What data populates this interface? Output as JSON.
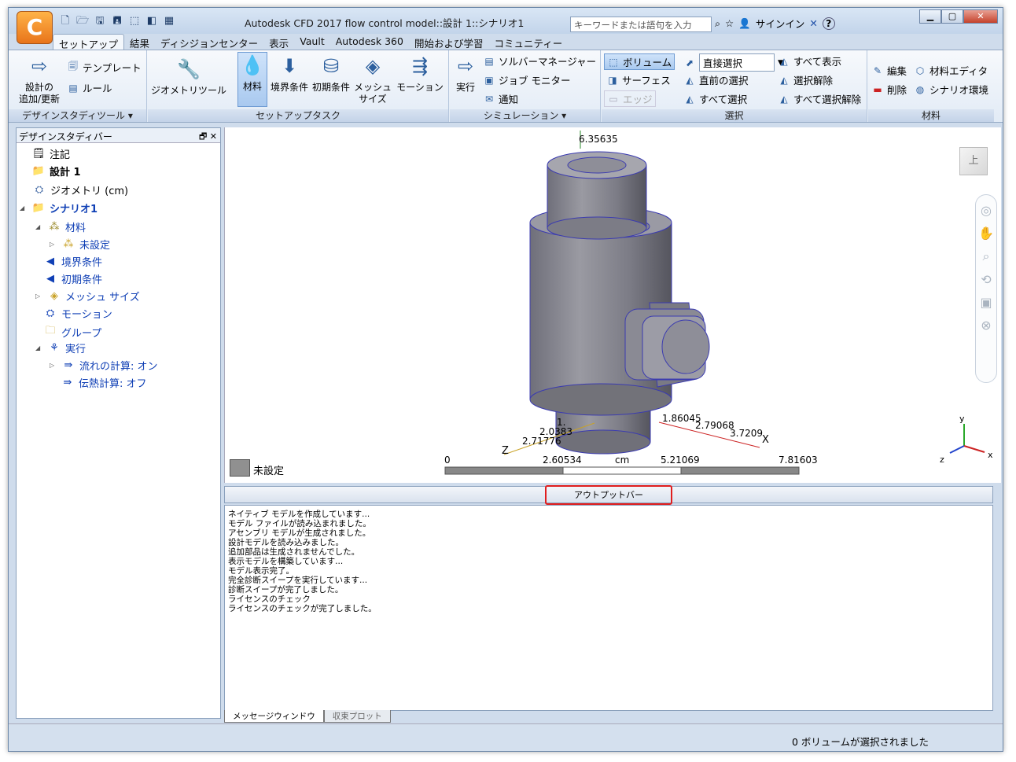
{
  "app": {
    "logo_letter": "C",
    "title": "Autodesk CFD 2017   flow control model::設計  1::シナリオ1",
    "search_placeholder": "キーワードまたは語句を入力",
    "signin": "サインイン",
    "help": "?"
  },
  "qat": [
    "new-icon",
    "open-icon",
    "save-icon",
    "save-as-icon",
    "select-icon",
    "cube-icon",
    "display-icon"
  ],
  "window_buttons": {
    "minimize": "▁",
    "maximize": "▢",
    "close": "✕"
  },
  "tabs": [
    "セットアップ",
    "結果",
    "ディシジョンセンター",
    "表示",
    "Vault",
    "Autodesk 360",
    "開始および学習",
    "コミュニティー"
  ],
  "ribbon": {
    "design_study": {
      "title": "デザインスタディツール ▾",
      "update_label": "設計の\n追加/更新",
      "template": "テンプレート",
      "rule": "ルール"
    },
    "setup_tasks": {
      "title": "セットアップタスク",
      "geometry_tools": "ジオメトリツール",
      "material": "材料",
      "boundary": "境界条件",
      "initial": "初期条件",
      "mesh": "メッシュ\nサイズ",
      "motion": "モーション"
    },
    "simulation": {
      "title": "シミュレーション ▾",
      "run": "実行",
      "solver_manager": "ソルバーマネージャー",
      "job_monitor": "ジョブ モニター",
      "notify": "通知"
    },
    "selection": {
      "title": "選択",
      "volume": "ボリューム",
      "surface": "サーフェス",
      "edge": "エッジ",
      "direct_select": "直接選択",
      "previous": "直前の選択",
      "select_all": "すべて選択",
      "show_all": "すべて表示",
      "deselect": "選択解除",
      "deselect_all": "すべて選択解除"
    },
    "material": {
      "title": "材料",
      "edit": "編集",
      "delete": "削除",
      "editor": "材料エディタ",
      "scenario_env": "シナリオ環境"
    }
  },
  "design_study_bar": {
    "title": "デザインスタディバー",
    "controls": "🗗 ✕",
    "tree": [
      {
        "label": "注記",
        "icon": "note-icon"
      },
      {
        "label": "設計  1",
        "icon": "design-icon"
      },
      {
        "label": "ジオメトリ (cm)",
        "icon": "geometry-icon"
      },
      {
        "label": "シナリオ1",
        "icon": "scenario-icon"
      },
      {
        "label": "材料",
        "icon": "material-icon"
      },
      {
        "label": "未設定",
        "icon": "material-icon"
      },
      {
        "label": "境界条件",
        "icon": "boundary-icon"
      },
      {
        "label": "初期条件",
        "icon": "initial-icon"
      },
      {
        "label": "メッシュ サイズ",
        "icon": "mesh-icon"
      },
      {
        "label": "モーション",
        "icon": "motion-icon"
      },
      {
        "label": "グループ",
        "icon": "group-icon"
      },
      {
        "label": "実行",
        "icon": "run-icon"
      },
      {
        "label": "流れの計算: オン",
        "icon": "flow-icon"
      },
      {
        "label": "伝熱計算: オフ",
        "icon": "heat-icon"
      }
    ]
  },
  "viewport": {
    "viewcube_label": "上",
    "ruler": {
      "t0": "0",
      "t1": "2.60534",
      "unit": "cm",
      "t2": "5.21069",
      "t3": "7.81603"
    },
    "axis_labels": {
      "top": "6.35635",
      "z1": "2.71776",
      "z2": "2.0383",
      "z3": "1.",
      "x1": "1.86045",
      "x2": "2.79068",
      "x3": "3.7209",
      "xl": "X",
      "zl": "Z",
      "x_axis": "x",
      "y_axis": "y",
      "z_axis": "z"
    },
    "legend_label": "未設定",
    "legend_color": "#909090"
  },
  "output_bar": {
    "label": "アウトプットバー",
    "messages": [
      "ネイティブ モデルを作成しています...",
      "モデル ファイルが読み込まれました。",
      "アセンブリ モデルが生成されました。",
      "設計モデルを読み込みました。",
      "追加部品は生成されませんでした。",
      "表示モデルを構築しています...",
      "モデル表示完了。",
      "完全診断スイープを実行しています...",
      "診断スイープが完了しました。",
      "ライセンスのチェック",
      "ライセンスのチェックが完了しました。"
    ],
    "tabs": [
      "メッセージウィンドウ",
      "収束プロット"
    ]
  },
  "status": {
    "text": "0 ボリュームが選択されました"
  }
}
